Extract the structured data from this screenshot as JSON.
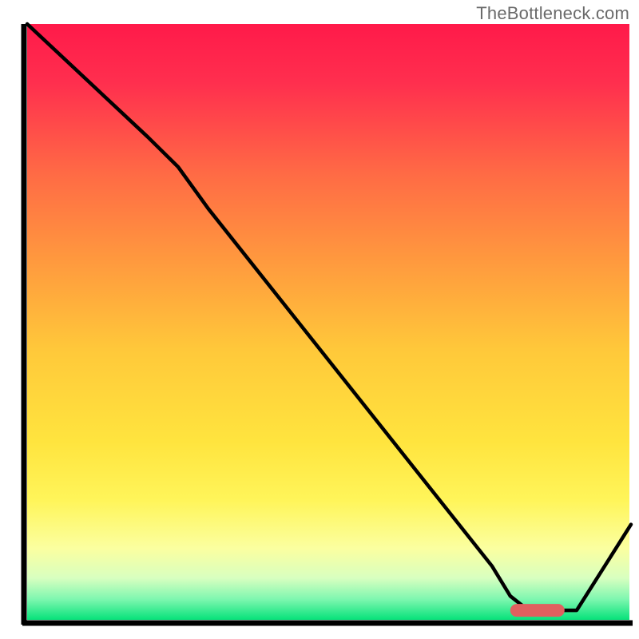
{
  "watermark": "TheBottleneck.com",
  "colors": {
    "curve": "#000000",
    "marker": "#e0605f",
    "axis": "#000000",
    "gradient_stops": [
      {
        "t": 0.0,
        "hex": "#ff1a4a"
      },
      {
        "t": 0.1,
        "hex": "#ff2f4e"
      },
      {
        "t": 0.25,
        "hex": "#ff6a45"
      },
      {
        "t": 0.4,
        "hex": "#ff9a3e"
      },
      {
        "t": 0.55,
        "hex": "#ffc93a"
      },
      {
        "t": 0.7,
        "hex": "#ffe43e"
      },
      {
        "t": 0.8,
        "hex": "#fff55a"
      },
      {
        "t": 0.88,
        "hex": "#fbffa0"
      },
      {
        "t": 0.93,
        "hex": "#d8ffc0"
      },
      {
        "t": 0.965,
        "hex": "#7ff7b0"
      },
      {
        "t": 1.0,
        "hex": "#06e27a"
      }
    ]
  },
  "chart_data": {
    "type": "line",
    "title": "",
    "xlabel": "",
    "ylabel": "",
    "xlim": [
      0,
      100
    ],
    "ylim": [
      0,
      100
    ],
    "grid": false,
    "legend": false,
    "series": [
      {
        "name": "bottleneck-curve",
        "x": [
          0,
          20,
          25,
          30,
          77,
          80,
          83,
          86,
          91,
          100
        ],
        "y": [
          100,
          81,
          76,
          69,
          9,
          4,
          1.6,
          1.6,
          1.6,
          16
        ]
      }
    ],
    "marker": {
      "name": "optimum-range",
      "x_range": [
        80,
        89
      ],
      "y": 1.6
    }
  }
}
